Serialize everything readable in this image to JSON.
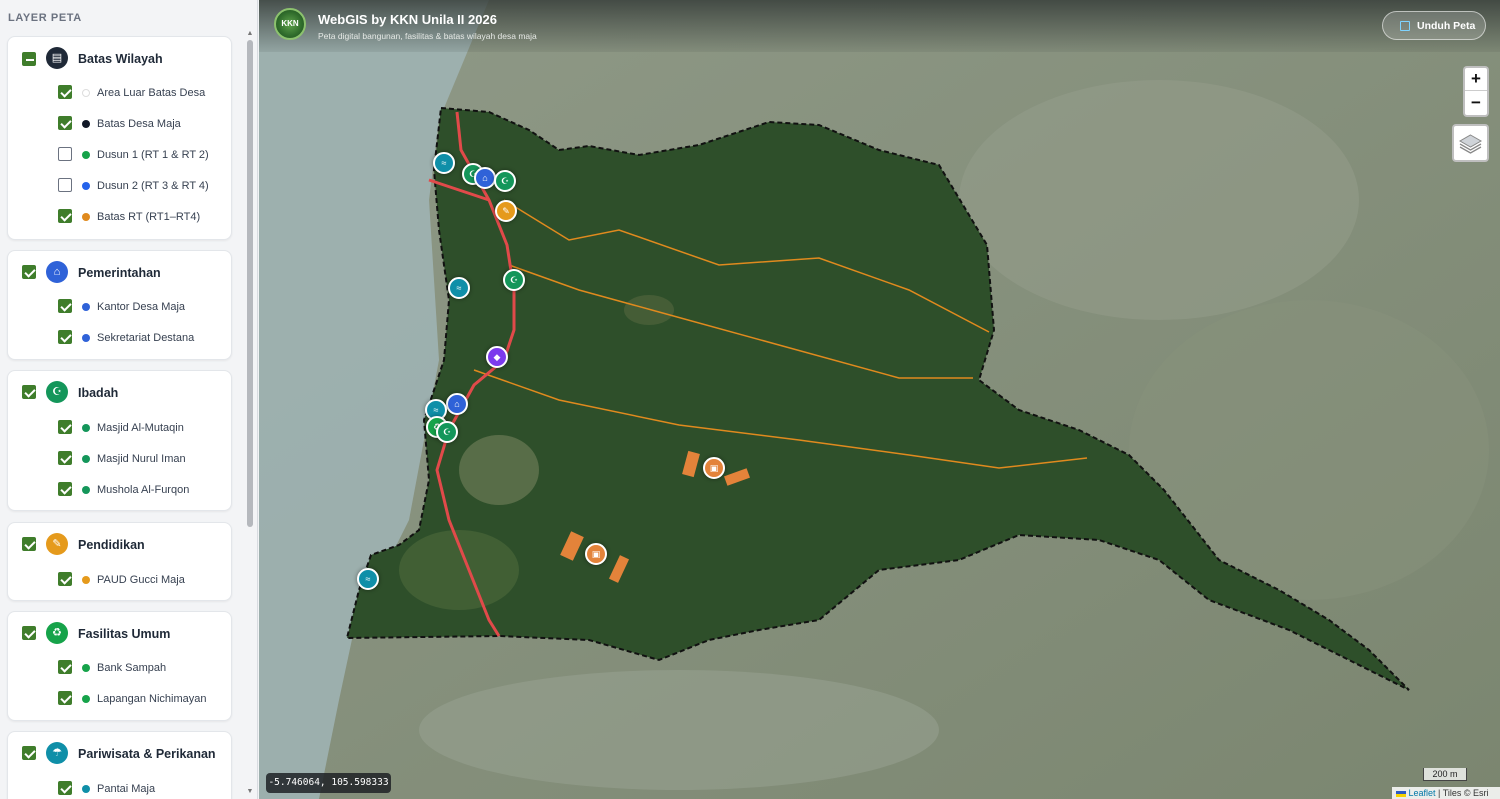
{
  "sidebar": {
    "title": "LAYER PETA",
    "groups": [
      {
        "label": "Batas Wilayah",
        "icon": "map-icon",
        "icon_color": "#1f2937",
        "state": "mixed",
        "items": [
          {
            "label": "Area Luar Batas Desa",
            "checked": true,
            "dot": "#ffffff"
          },
          {
            "label": "Batas Desa Maja",
            "checked": true,
            "dot": "#111827"
          },
          {
            "label": "Dusun 1 (RT 1 & RT 2)",
            "checked": false,
            "dot": "#16a34a"
          },
          {
            "label": "Dusun 2 (RT 3 & RT 4)",
            "checked": false,
            "dot": "#2563eb"
          },
          {
            "label": "Batas RT (RT1–RT4)",
            "checked": true,
            "dot": "#e08a1e"
          }
        ]
      },
      {
        "label": "Pemerintahan",
        "icon": "government-building-icon",
        "icon_color": "#2f62d8",
        "state": "checked",
        "items": [
          {
            "label": "Kantor Desa Maja",
            "checked": true,
            "dot": "#2f62d8"
          },
          {
            "label": "Sekretariat Destana",
            "checked": true,
            "dot": "#2f62d8"
          }
        ]
      },
      {
        "label": "Ibadah",
        "icon": "mosque-icon",
        "icon_color": "#14965a",
        "state": "checked",
        "items": [
          {
            "label": "Masjid Al-Mutaqin",
            "checked": true,
            "dot": "#14965a"
          },
          {
            "label": "Masjid Nurul Iman",
            "checked": true,
            "dot": "#14965a"
          },
          {
            "label": "Mushola Al-Furqon",
            "checked": true,
            "dot": "#14965a"
          }
        ]
      },
      {
        "label": "Pendidikan",
        "icon": "school-icon",
        "icon_color": "#e59a1c",
        "state": "checked",
        "items": [
          {
            "label": "PAUD Gucci Maja",
            "checked": true,
            "dot": "#e59a1c"
          }
        ]
      },
      {
        "label": "Fasilitas Umum",
        "icon": "recycle-icon",
        "icon_color": "#16a34a",
        "state": "checked",
        "items": [
          {
            "label": "Bank Sampah",
            "checked": true,
            "dot": "#16a34a"
          },
          {
            "label": "Lapangan Nichimayan",
            "checked": true,
            "dot": "#16a34a"
          }
        ]
      },
      {
        "label": "Pariwisata & Perikanan",
        "icon": "beach-icon",
        "icon_color": "#0f8fa8",
        "state": "checked",
        "items": [
          {
            "label": "Pantai Maja",
            "checked": true,
            "dot": "#0f8fa8"
          }
        ]
      }
    ]
  },
  "map": {
    "title": "WebGIS by KKN Unila II 2026",
    "subtitle": "Peta digital bangunan, fasilitas & batas wilayah desa maja",
    "logo_text": "KKN",
    "download_label": "Unduh Peta",
    "zoom_in": "+",
    "zoom_out": "−",
    "coords": "-5.746064, 105.598333",
    "scale": "200 m",
    "attribution_link": "Leaflet",
    "attribution_tail": " | Tiles © Esri",
    "colors": {
      "boundary": "#111111",
      "rt_lines": "#e08a1e",
      "road": "#e14a4a",
      "vegetation": "#2e4f2a"
    }
  }
}
